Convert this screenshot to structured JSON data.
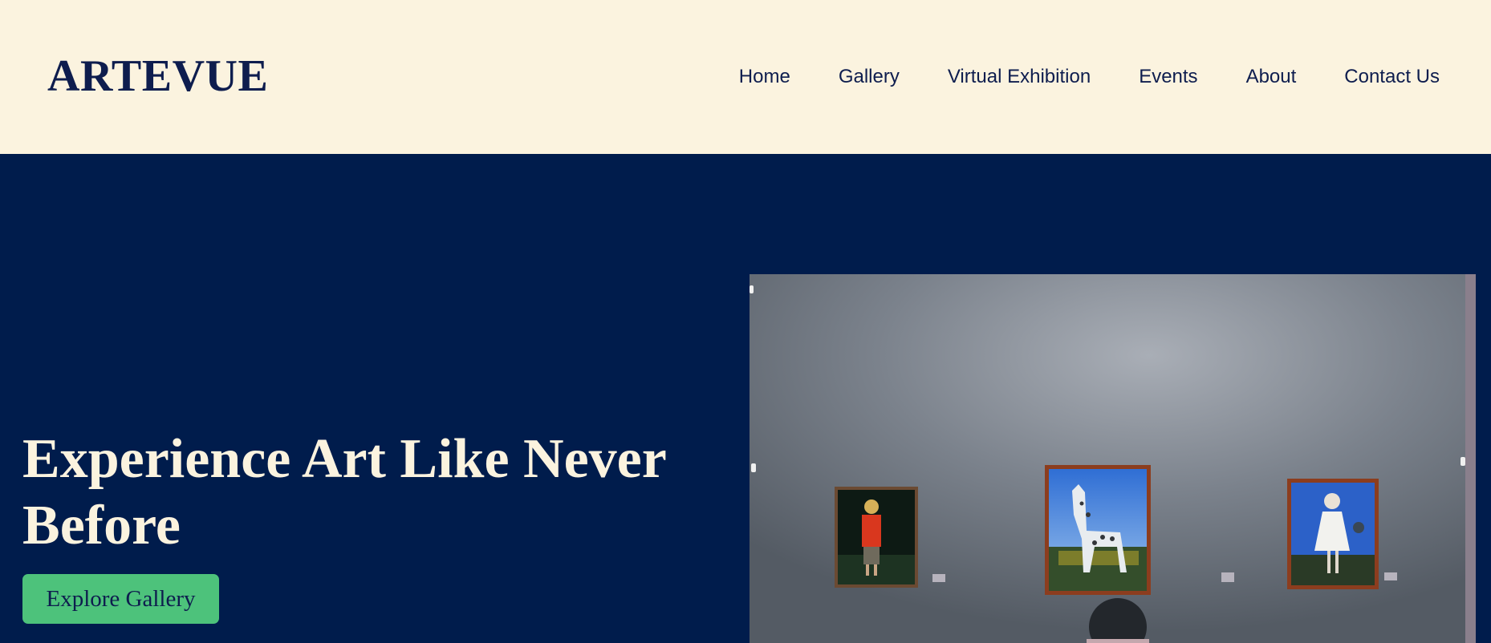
{
  "header": {
    "logo": "ARTEVUE",
    "nav": [
      {
        "label": "Home"
      },
      {
        "label": "Gallery"
      },
      {
        "label": "Virtual Exhibition"
      },
      {
        "label": "Events"
      },
      {
        "label": "About"
      },
      {
        "label": "Contact Us"
      }
    ]
  },
  "hero": {
    "title": "Experience Art Like Never Before",
    "cta_label": "Explore Gallery",
    "image_subject": "gallery-wall-with-three-framed-paintings"
  },
  "colors": {
    "header_bg": "#fbf3df",
    "hero_bg": "#001c4c",
    "text_navy": "#0e1d4e",
    "text_cream": "#fbf3df",
    "button_green": "#4dc27b"
  }
}
